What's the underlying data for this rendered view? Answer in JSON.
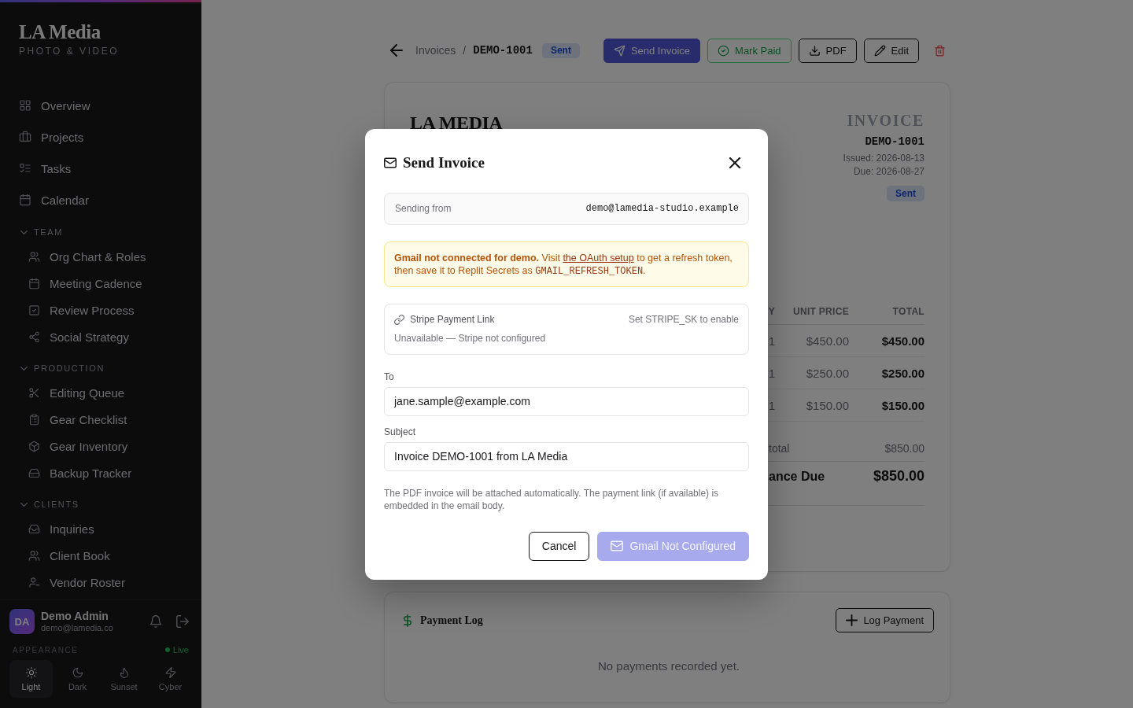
{
  "sidebar": {
    "logo": "LA Media",
    "tagline": "PHOTO & VIDEO",
    "nav": [
      {
        "label": "Overview",
        "selected": false
      },
      {
        "label": "Projects",
        "selected": false
      },
      {
        "label": "Tasks",
        "selected": false
      },
      {
        "label": "Calendar",
        "selected": false
      }
    ],
    "sections": [
      {
        "title": "TEAM",
        "expanded": true,
        "items": [
          {
            "label": "Org Chart & Roles",
            "selected": false
          },
          {
            "label": "Meeting Cadence",
            "selected": false
          },
          {
            "label": "Review Process",
            "selected": false
          },
          {
            "label": "Social Strategy",
            "selected": false
          }
        ]
      },
      {
        "title": "PRODUCTION",
        "expanded": true,
        "items": [
          {
            "label": "Editing Queue",
            "selected": false
          },
          {
            "label": "Gear Checklist",
            "selected": false
          },
          {
            "label": "Gear Inventory",
            "selected": false
          },
          {
            "label": "Backup Tracker",
            "selected": false
          }
        ]
      },
      {
        "title": "CLIENTS",
        "expanded": true,
        "items": [
          {
            "label": "Inquiries",
            "selected": false
          },
          {
            "label": "Client Book",
            "selected": false
          },
          {
            "label": "Vendor Roster",
            "selected": false
          }
        ]
      }
    ],
    "user": {
      "initials": "DA",
      "name": "Demo Admin",
      "email": "demo@lamedia.co"
    },
    "appearance": {
      "label": "APPEARANCE",
      "status": "Live",
      "themes": [
        {
          "label": "Light",
          "selected": true
        },
        {
          "label": "Dark",
          "selected": false
        },
        {
          "label": "Sunset",
          "selected": false
        },
        {
          "label": "Cyber",
          "selected": false
        }
      ]
    }
  },
  "header": {
    "parent": "Invoices",
    "separator": "/",
    "current": "DEMO-1001",
    "status": "Sent",
    "actions": [
      {
        "label": "Send Invoice",
        "kind": "primary"
      },
      {
        "label": "Mark Paid",
        "kind": "success"
      },
      {
        "label": "PDF",
        "kind": "outline"
      },
      {
        "label": "Edit",
        "kind": "outline"
      },
      {
        "kind": "danger"
      }
    ]
  },
  "invoice": {
    "brand": "LA MEDIA",
    "title": "INVOICE",
    "number": "DEMO-1001",
    "issued": "Issued: 2026-08-13",
    "due": "Due: 2026-08-27",
    "status": "Sent",
    "table": {
      "columns": [
        "Y",
        "UNIT PRICE",
        "TOTAL"
      ],
      "rows": [
        [
          "1",
          "$450.00",
          "$450.00"
        ],
        [
          "1",
          "$250.00",
          "$250.00"
        ],
        [
          "1",
          "$150.00",
          "$150.00"
        ]
      ]
    },
    "subtotal": {
      "label": "total",
      "value": "$850.00"
    },
    "balance": {
      "label": "ance Due",
      "value": "$850.00"
    }
  },
  "payment_log": {
    "title": "Payment Log",
    "button": "Log Payment",
    "empty": "No payments recorded yet."
  },
  "modal": {
    "title": "Send Invoice",
    "sending_from": {
      "label": "Sending from",
      "value": "demo@lamedia-studio.example"
    },
    "warning": [
      {
        "kind": "text",
        "text": "**Gmail not connected for demo.** Visit "
      },
      {
        "kind": "link",
        "text": "the OAuth setup"
      },
      {
        "kind": "text",
        "text": " to get a refresh token, then save it to Replit Secrets as "
      },
      {
        "kind": "code",
        "text": "GMAIL_REFRESH_TOKEN"
      },
      {
        "kind": "text",
        "text": "."
      }
    ],
    "stripe": {
      "title": "Stripe Payment Link",
      "hint": "Set STRIPE_SK to enable",
      "status": "Unavailable — Stripe not configured"
    },
    "fields": [
      {
        "label": "To",
        "value": "jane.sample@example.com"
      },
      {
        "label": "Subject",
        "value": "Invoice DEMO-1001 from LA Media"
      }
    ],
    "note": "The PDF invoice will be attached automatically. The payment link (if available) is embedded in the email body.",
    "buttons": [
      {
        "label": "Cancel",
        "kind": "secondary",
        "disabled": false
      },
      {
        "label": "Gmail Not Configured",
        "kind": "primary",
        "disabled": true
      }
    ]
  }
}
